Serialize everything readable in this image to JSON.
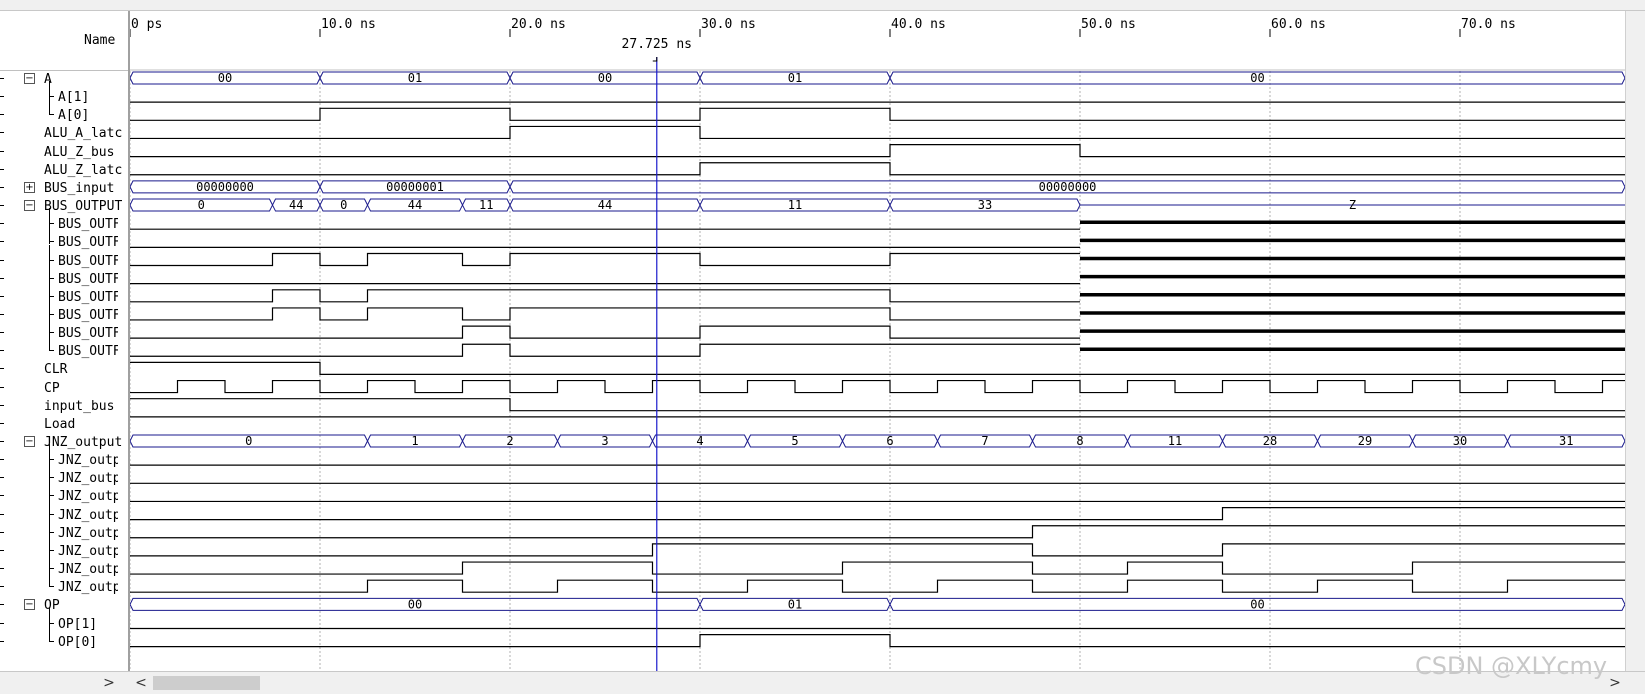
{
  "header": {
    "name_label": "Name"
  },
  "cursor": {
    "label": "27.725 ns",
    "time_ns": 27.725
  },
  "time_axis": {
    "ticks": [
      {
        "t": 0,
        "label": "0 ps"
      },
      {
        "t": 10,
        "label": "10.0 ns"
      },
      {
        "t": 20,
        "label": "20.0 ns"
      },
      {
        "t": 30,
        "label": "30.0 ns"
      },
      {
        "t": 40,
        "label": "40.0 ns"
      },
      {
        "t": 50,
        "label": "50.0 ns"
      },
      {
        "t": 60,
        "label": "60.0 ns"
      },
      {
        "t": 70,
        "label": "70.0 ns"
      }
    ]
  },
  "signals": [
    {
      "label": "A",
      "expander": "minus",
      "kind": "bus",
      "values": [
        [
          0,
          "00"
        ],
        [
          10,
          "01"
        ],
        [
          20,
          "00"
        ],
        [
          30,
          "01"
        ],
        [
          40,
          "00"
        ]
      ]
    },
    {
      "label": "A[1]",
      "child": "mid",
      "kind": "bit",
      "changes": [
        [
          0,
          0
        ]
      ]
    },
    {
      "label": "A[0]",
      "child": "last",
      "kind": "bit",
      "changes": [
        [
          0,
          0
        ],
        [
          10,
          1
        ],
        [
          20,
          0
        ],
        [
          30,
          1
        ],
        [
          40,
          0
        ]
      ]
    },
    {
      "label": "ALU_A_latc",
      "kind": "bit",
      "changes": [
        [
          0,
          0
        ],
        [
          20,
          1
        ],
        [
          30,
          0
        ]
      ]
    },
    {
      "label": "ALU_Z_bus",
      "kind": "bit",
      "changes": [
        [
          0,
          0
        ],
        [
          40,
          1
        ],
        [
          50,
          0
        ]
      ]
    },
    {
      "label": "ALU_Z_latc",
      "kind": "bit",
      "changes": [
        [
          0,
          0
        ],
        [
          30,
          1
        ],
        [
          40,
          0
        ]
      ]
    },
    {
      "label": "BUS_input",
      "expander": "plus",
      "kind": "bus",
      "values": [
        [
          0,
          "00000000"
        ],
        [
          10,
          "00000001"
        ],
        [
          20,
          "00000000"
        ]
      ]
    },
    {
      "label": "BUS_OUTPUT",
      "expander": "minus",
      "kind": "bus",
      "values": [
        [
          0,
          "0"
        ],
        [
          7.5,
          "44"
        ],
        [
          10,
          "0"
        ],
        [
          12.5,
          "44"
        ],
        [
          17.5,
          "11"
        ],
        [
          20,
          "44"
        ],
        [
          30,
          "11"
        ],
        [
          40,
          "33"
        ],
        [
          50,
          "Z"
        ]
      ]
    },
    {
      "label": "BUS_OUTF",
      "child": "mid",
      "kind": "bit",
      "changes": [
        [
          0,
          0
        ],
        [
          50,
          "z"
        ]
      ]
    },
    {
      "label": "BUS_OUTF",
      "child": "mid",
      "kind": "bit",
      "changes": [
        [
          0,
          0
        ],
        [
          50,
          "z"
        ]
      ]
    },
    {
      "label": "BUS_OUTF",
      "child": "mid",
      "kind": "bit",
      "changes": [
        [
          0,
          0
        ],
        [
          7.5,
          1
        ],
        [
          10,
          0
        ],
        [
          12.5,
          1
        ],
        [
          17.5,
          0
        ],
        [
          20,
          1
        ],
        [
          30,
          0
        ],
        [
          40,
          1
        ],
        [
          50,
          "z"
        ]
      ]
    },
    {
      "label": "BUS_OUTF",
      "child": "mid",
      "kind": "bit",
      "changes": [
        [
          0,
          0
        ],
        [
          50,
          "z"
        ]
      ]
    },
    {
      "label": "BUS_OUTF",
      "child": "mid",
      "kind": "bit",
      "changes": [
        [
          0,
          0
        ],
        [
          7.5,
          1
        ],
        [
          10,
          0
        ],
        [
          12.5,
          1
        ],
        [
          40,
          0
        ],
        [
          50,
          "z"
        ]
      ]
    },
    {
      "label": "BUS_OUTF",
      "child": "mid",
      "kind": "bit",
      "changes": [
        [
          0,
          0
        ],
        [
          7.5,
          1
        ],
        [
          10,
          0
        ],
        [
          12.5,
          1
        ],
        [
          17.5,
          0
        ],
        [
          20,
          1
        ],
        [
          40,
          0
        ],
        [
          50,
          "z"
        ]
      ]
    },
    {
      "label": "BUS_OUTF",
      "child": "mid",
      "kind": "bit",
      "changes": [
        [
          0,
          0
        ],
        [
          17.5,
          1
        ],
        [
          20,
          0
        ],
        [
          30,
          1
        ],
        [
          40,
          0
        ],
        [
          50,
          "z"
        ]
      ]
    },
    {
      "label": "BUS_OUTF",
      "child": "last",
      "kind": "bit",
      "changes": [
        [
          0,
          0
        ],
        [
          17.5,
          1
        ],
        [
          20,
          0
        ],
        [
          30,
          1
        ],
        [
          50,
          "z"
        ]
      ]
    },
    {
      "label": "CLR",
      "kind": "bit",
      "changes": [
        [
          0,
          1
        ],
        [
          10,
          0
        ]
      ]
    },
    {
      "label": "CP",
      "kind": "clock",
      "start": 0,
      "half_period": 2.5,
      "first_rise": 2.5
    },
    {
      "label": "input_bus",
      "kind": "bit",
      "changes": [
        [
          0,
          1
        ],
        [
          20,
          0
        ]
      ]
    },
    {
      "label": "Load",
      "kind": "bit",
      "changes": [
        [
          0,
          1
        ]
      ]
    },
    {
      "label": "JNZ_output",
      "expander": "minus",
      "kind": "bus",
      "values": [
        [
          0,
          "0"
        ],
        [
          12.5,
          "1"
        ],
        [
          17.5,
          "2"
        ],
        [
          22.5,
          "3"
        ],
        [
          27.5,
          "4"
        ],
        [
          32.5,
          "5"
        ],
        [
          37.5,
          "6"
        ],
        [
          42.5,
          "7"
        ],
        [
          47.5,
          "8"
        ],
        [
          52.5,
          "11"
        ],
        [
          57.5,
          "28"
        ],
        [
          62.5,
          "29"
        ],
        [
          67.5,
          "30"
        ],
        [
          72.5,
          "31"
        ]
      ]
    },
    {
      "label": "JNZ_outp",
      "child": "mid",
      "kind": "bit",
      "changes": [
        [
          0,
          0
        ]
      ]
    },
    {
      "label": "JNZ_outp",
      "child": "mid",
      "kind": "bit",
      "changes": [
        [
          0,
          0
        ]
      ]
    },
    {
      "label": "JNZ_outp",
      "child": "mid",
      "kind": "bit",
      "changes": [
        [
          0,
          0
        ]
      ]
    },
    {
      "label": "JNZ_outp",
      "child": "mid",
      "kind": "bit",
      "changes": [
        [
          0,
          0
        ],
        [
          57.5,
          1
        ]
      ]
    },
    {
      "label": "JNZ_outp",
      "child": "mid",
      "kind": "bit",
      "changes": [
        [
          0,
          0
        ],
        [
          47.5,
          1
        ]
      ]
    },
    {
      "label": "JNZ_outp",
      "child": "mid",
      "kind": "bit",
      "changes": [
        [
          0,
          0
        ],
        [
          27.5,
          1
        ],
        [
          47.5,
          0
        ],
        [
          57.5,
          1
        ]
      ]
    },
    {
      "label": "JNZ_outp",
      "child": "mid",
      "kind": "bit",
      "changes": [
        [
          0,
          0
        ],
        [
          17.5,
          1
        ],
        [
          27.5,
          0
        ],
        [
          37.5,
          1
        ],
        [
          47.5,
          0
        ],
        [
          52.5,
          1
        ],
        [
          57.5,
          0
        ],
        [
          67.5,
          1
        ]
      ]
    },
    {
      "label": "JNZ_outp",
      "child": "last",
      "kind": "bit",
      "changes": [
        [
          0,
          0
        ],
        [
          12.5,
          1
        ],
        [
          17.5,
          0
        ],
        [
          22.5,
          1
        ],
        [
          27.5,
          0
        ],
        [
          32.5,
          1
        ],
        [
          37.5,
          0
        ],
        [
          42.5,
          1
        ],
        [
          47.5,
          0
        ],
        [
          52.5,
          1
        ],
        [
          57.5,
          0
        ],
        [
          62.5,
          1
        ],
        [
          67.5,
          0
        ],
        [
          72.5,
          1
        ]
      ]
    },
    {
      "label": "OP",
      "expander": "minus",
      "kind": "bus",
      "values": [
        [
          0,
          "00"
        ],
        [
          30,
          "01"
        ],
        [
          40,
          "00"
        ]
      ]
    },
    {
      "label": "OP[1]",
      "child": "mid",
      "kind": "bit",
      "changes": [
        [
          0,
          0
        ]
      ]
    },
    {
      "label": "OP[0]",
      "child": "last",
      "kind": "bit",
      "changes": [
        [
          0,
          0
        ],
        [
          30,
          1
        ],
        [
          40,
          0
        ]
      ]
    }
  ],
  "colors": {
    "bus_outline": "#1a1a8c",
    "wave": "#000000",
    "cursor": "#1a1acc",
    "grid": "#b0b0b0"
  },
  "scrollbar": {
    "right_arrow": ">",
    "left_arrow": "<",
    "down_arrow": "v"
  },
  "watermark": "CSDN @XLYcmy"
}
